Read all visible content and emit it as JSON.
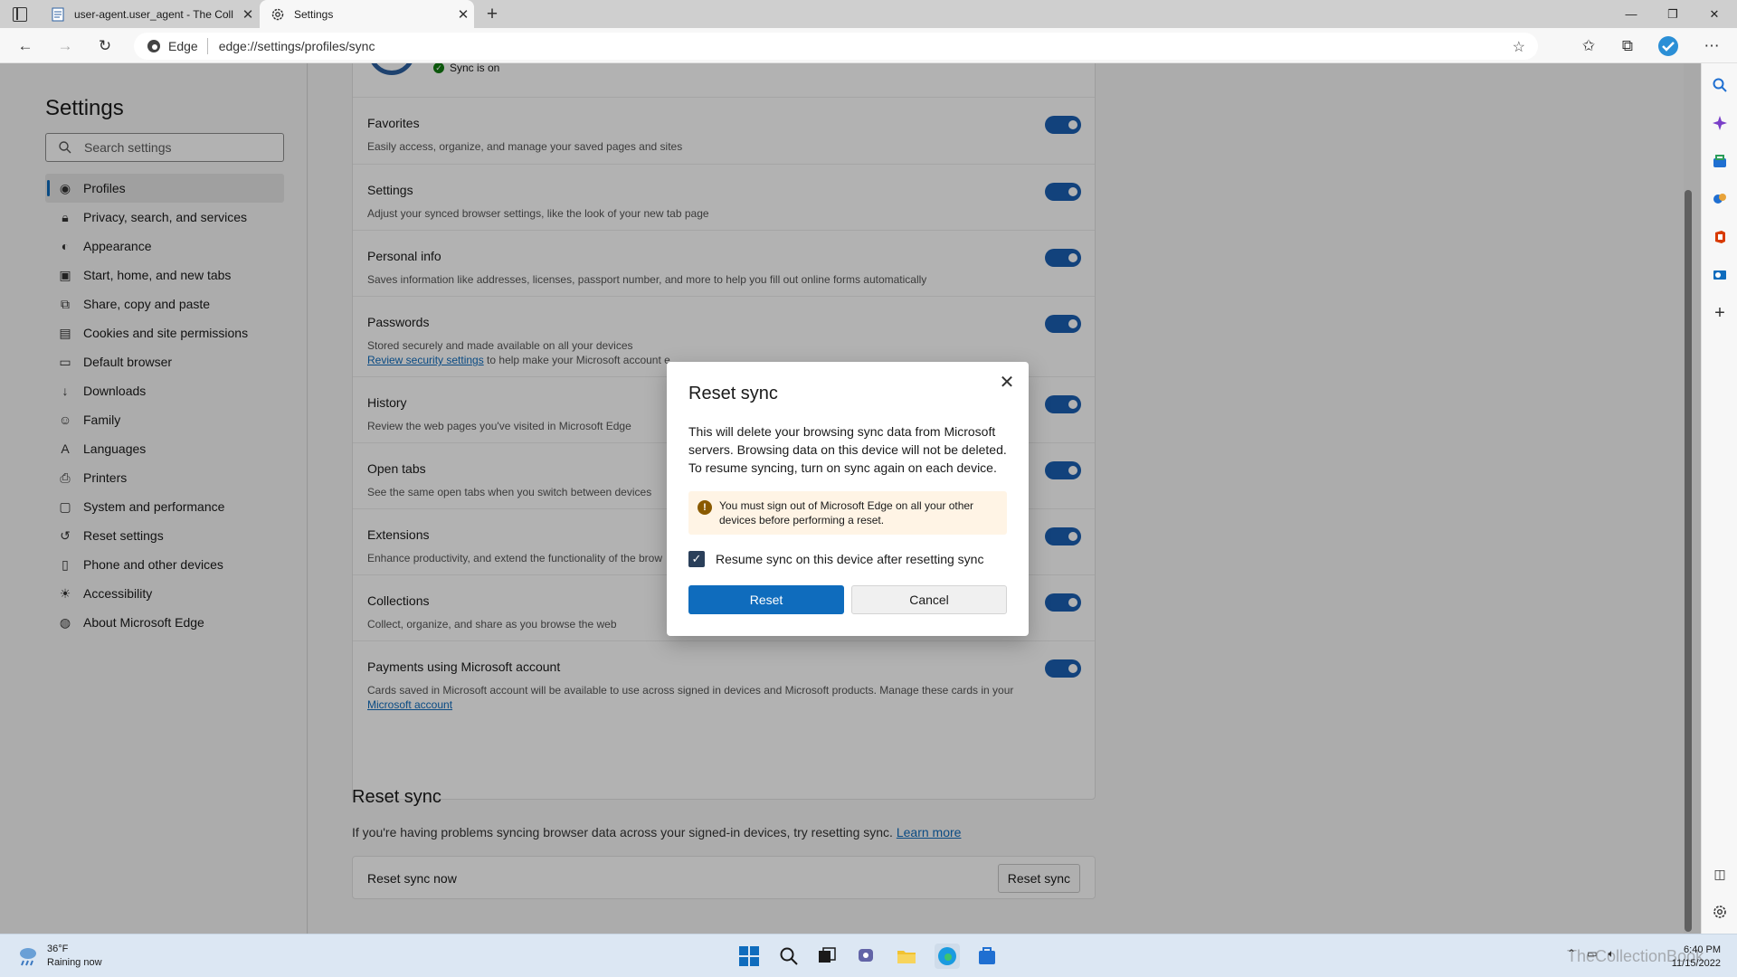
{
  "tabs": [
    {
      "title": "user-agent.user_agent - The Coll",
      "active": false
    },
    {
      "title": "Settings",
      "active": true
    }
  ],
  "window_controls": {
    "minimize": "—",
    "restore": "❐",
    "close": "✕"
  },
  "address_bar": {
    "site_label": "Edge",
    "url": "edge://settings/profiles/sync"
  },
  "settings_nav": {
    "title": "Settings",
    "search_placeholder": "Search settings",
    "items": [
      {
        "label": "Profiles",
        "icon": "profile-icon",
        "active": true
      },
      {
        "label": "Privacy, search, and services",
        "icon": "lock-icon"
      },
      {
        "label": "Appearance",
        "icon": "appearance-icon"
      },
      {
        "label": "Start, home, and new tabs",
        "icon": "home-icon"
      },
      {
        "label": "Share, copy and paste",
        "icon": "share-icon"
      },
      {
        "label": "Cookies and site permissions",
        "icon": "cookie-icon"
      },
      {
        "label": "Default browser",
        "icon": "browser-icon"
      },
      {
        "label": "Downloads",
        "icon": "download-icon"
      },
      {
        "label": "Family",
        "icon": "family-icon"
      },
      {
        "label": "Languages",
        "icon": "language-icon"
      },
      {
        "label": "Printers",
        "icon": "printer-icon"
      },
      {
        "label": "System and performance",
        "icon": "system-icon"
      },
      {
        "label": "Reset settings",
        "icon": "reset-icon"
      },
      {
        "label": "Phone and other devices",
        "icon": "phone-icon"
      },
      {
        "label": "Accessibility",
        "icon": "accessibility-icon"
      },
      {
        "label": "About Microsoft Edge",
        "icon": "edge-icon"
      }
    ]
  },
  "sync": {
    "status": "Sync is on",
    "rows": [
      {
        "title": "Favorites",
        "desc": "Easily access, organize, and manage your saved pages and sites",
        "on": true
      },
      {
        "title": "Settings",
        "desc": "Adjust your synced browser settings, like the look of your new tab page",
        "on": true
      },
      {
        "title": "Personal info",
        "desc": "Saves information like addresses, licenses, passport number, and more to help you fill out online forms automatically",
        "on": true
      },
      {
        "title": "Passwords",
        "desc": "Stored securely and made available on all your devices",
        "link": "Review security settings",
        "desc_suffix": " to help make your Microsoft account e",
        "on": true
      },
      {
        "title": "History",
        "desc": "Review the web pages you've visited in Microsoft Edge",
        "on": true
      },
      {
        "title": "Open tabs",
        "desc": "See the same open tabs when you switch between devices",
        "on": true
      },
      {
        "title": "Extensions",
        "desc": "Enhance productivity, and extend the functionality of the brow",
        "on": true
      },
      {
        "title": "Collections",
        "desc": "Collect, organize, and share as you browse the web",
        "on": true
      },
      {
        "title": "Payments using Microsoft account",
        "desc": "Cards saved in Microsoft account will be available to use across signed in devices and Microsoft products. Manage these cards in your ",
        "link": "Microsoft account",
        "on": true
      }
    ]
  },
  "reset_section": {
    "heading": "Reset sync",
    "desc": "If you're having problems syncing browser data across your signed-in devices, try resetting sync.",
    "learn_more": "Learn more",
    "row_label": "Reset sync now",
    "button": "Reset sync"
  },
  "dialog": {
    "title": "Reset sync",
    "body": "This will delete your browsing sync data from Microsoft servers. Browsing data on this device will not be deleted. To resume syncing, turn on sync again on each device.",
    "warning": "You must sign out of Microsoft Edge on all your other devices before performing a reset.",
    "checkbox_label": "Resume sync on this device after resetting sync",
    "checkbox_checked": true,
    "reset_button": "Reset",
    "cancel_button": "Cancel"
  },
  "taskbar": {
    "weather_temp": "36°F",
    "weather_desc": "Raining now",
    "time": "6:40 PM",
    "date": "11/15/2022",
    "watermark": "TheCollectionBook"
  },
  "colors": {
    "accent": "#0f6cbd",
    "toggle_on": "#1b5fb2",
    "sync_green": "#107c10"
  }
}
